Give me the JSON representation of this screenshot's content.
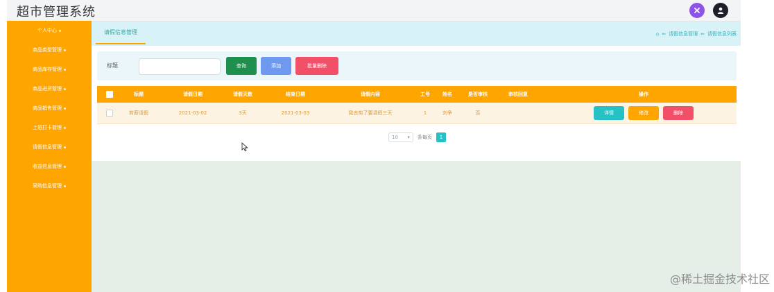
{
  "app": {
    "title": "超市管理系统"
  },
  "header_icons": [
    "close-circle-icon",
    "user-avatar-icon"
  ],
  "sidebar": {
    "items": [
      {
        "label": "个人中心"
      },
      {
        "label": "商品类型管理"
      },
      {
        "label": "商品库存管理"
      },
      {
        "label": "商品进货管理"
      },
      {
        "label": "商品销售管理"
      },
      {
        "label": "上班打卡管理"
      },
      {
        "label": "请假信息管理"
      },
      {
        "label": "收益信息管理"
      },
      {
        "label": "采购信息管理"
      }
    ]
  },
  "tabs": {
    "active": "请假信息管理"
  },
  "breadcrumb": {
    "home": "⌂",
    "sep": "⇐",
    "level1": "请假信息管理",
    "level2": "请假信息列表"
  },
  "search": {
    "label": "标题",
    "value": "",
    "placeholder": ""
  },
  "buttons": {
    "query": "查询",
    "add": "添加",
    "batch_delete": "批量删除"
  },
  "table": {
    "headers": [
      "标题",
      "请假日期",
      "请假天数",
      "结束日期",
      "请假内容",
      "工号",
      "姓名",
      "是否审核",
      "审核回复",
      "操作"
    ],
    "rows": [
      {
        "title": "剪薪请假",
        "start_date": "2021-03-02",
        "days": "3天",
        "end_date": "2021-03-03",
        "content": "我去剪了要请假三天",
        "job_no": "1",
        "name": "刘争",
        "approved": "否",
        "reply": "",
        "actions": {
          "detail": "详情",
          "edit": "修改",
          "delete": "删除"
        }
      }
    ]
  },
  "pagination": {
    "page_size": "10",
    "per_page_label": "条每页",
    "current_page": "1"
  },
  "watermark": "@稀土掘金技术社区",
  "colors": {
    "sidebar": "#ffa500",
    "header_row": "#ffa500",
    "accent_teal": "#25c1c4",
    "danger": "#f25068",
    "success": "#1f8f4e",
    "primary": "#6f98ef"
  }
}
